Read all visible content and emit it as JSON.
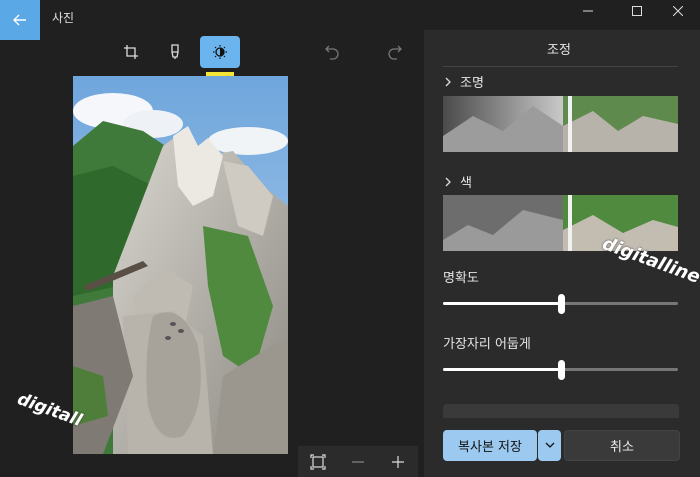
{
  "app": {
    "title": "사진"
  },
  "toolbar": {
    "tooltip": "조정",
    "tools": [
      "crop-icon",
      "markup-icon",
      "adjust-icon",
      "undo-icon",
      "redo-icon"
    ]
  },
  "panel": {
    "title": "조정",
    "sections": [
      {
        "label": "조명"
      },
      {
        "label": "색"
      }
    ],
    "sliders": [
      {
        "label": "명확도",
        "value": 0.5
      },
      {
        "label": "가장자리 어둡게",
        "value": 0.5
      }
    ],
    "save_label": "복사본 저장",
    "cancel_label": "취소"
  },
  "watermarks": [
    "digitalline",
    "digitall"
  ],
  "colors": {
    "accent": "#6cb4ee",
    "save_button": "#9cc9f0",
    "tooltip_bg": "#f5e536",
    "tooltip_text": "#d0352b"
  }
}
